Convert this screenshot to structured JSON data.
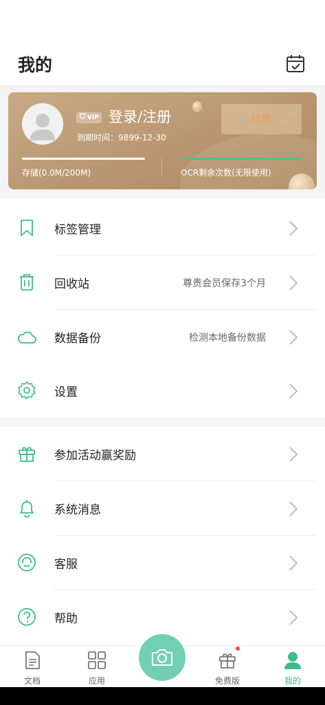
{
  "header": {
    "title": "我的",
    "calendar_icon": "calendar-check-icon"
  },
  "vip_card": {
    "vip_badge": "VIP",
    "login_label": "登录/注册",
    "expire_text": "到期时间：9899-12-30",
    "renew_label": "续费",
    "storage_text": "存储(0.0M/200M)",
    "ocr_text": "OCR剩余次数(无限使用)",
    "colors": {
      "card": "#b99670",
      "renew_text": "#f0a04b",
      "ocr_bar": "#4cc08a"
    }
  },
  "menu_group1": [
    {
      "label": "标签管理",
      "hint": "",
      "icon": "bookmark-icon"
    },
    {
      "label": "回收站",
      "hint": "尊贵会员保存3个月",
      "icon": "trash-icon"
    },
    {
      "label": "数据备份",
      "hint": "检测本地备份数据",
      "icon": "cloud-icon"
    },
    {
      "label": "设置",
      "hint": "",
      "icon": "gear-icon"
    }
  ],
  "menu_group2": [
    {
      "label": "参加活动赢奖励",
      "hint": "",
      "icon": "gift-icon"
    },
    {
      "label": "系统消息",
      "hint": "",
      "icon": "bell-icon"
    },
    {
      "label": "客服",
      "hint": "",
      "icon": "headset-icon"
    },
    {
      "label": "帮助",
      "hint": "",
      "icon": "question-icon"
    }
  ],
  "bottom_nav": {
    "items": [
      {
        "label": "文档",
        "icon": "document-icon",
        "active": false
      },
      {
        "label": "应用",
        "icon": "apps-grid-icon",
        "active": false
      },
      {
        "label": "免费版",
        "icon": "gift-icon",
        "active": false,
        "badge": true
      },
      {
        "label": "我的",
        "icon": "person-icon",
        "active": true
      }
    ],
    "camera_icon": "camera-icon",
    "colors": {
      "accent": "#3dbd8c",
      "camera_bg": "#71cfb2"
    }
  }
}
